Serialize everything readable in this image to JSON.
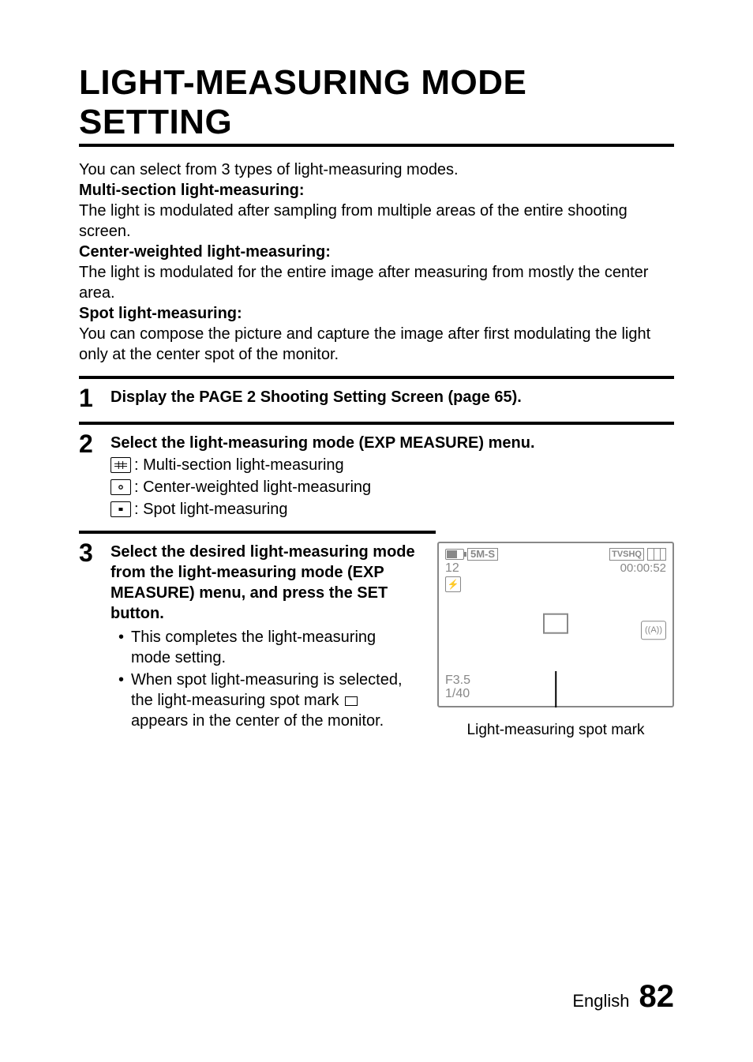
{
  "title": "LIGHT-MEASURING MODE SETTING",
  "intro": {
    "line1": "You can select from 3 types of light-measuring modes.",
    "mode1_h": "Multi-section light-measuring:",
    "mode1_b": "The light is modulated after sampling from multiple areas of the entire shooting screen.",
    "mode2_h": "Center-weighted light-measuring:",
    "mode2_b": "The light is modulated for the entire image after measuring from mostly the center area.",
    "mode3_h": "Spot light-measuring:",
    "mode3_b": "You can compose the picture and capture the image after first modulating the light only at the center spot of the monitor."
  },
  "steps": {
    "s1": {
      "num": "1",
      "title": "Display the PAGE 2 Shooting Setting Screen (page 65)."
    },
    "s2": {
      "num": "2",
      "title": "Select the light-measuring mode (EXP MEASURE) menu.",
      "opts": {
        "a": ": Multi-section light-measuring",
        "b": ": Center-weighted light-measuring",
        "c": ": Spot light-measuring"
      }
    },
    "s3": {
      "num": "3",
      "title": "Select the desired light-measuring mode from the light-measuring mode (EXP MEASURE) menu, and press the SET button.",
      "b1": "This completes the light-measuring mode setting.",
      "b2a": "When spot light-measuring is selected, the light-measuring spot mark ",
      "b2b": " appears in the center of the monitor."
    }
  },
  "lcd": {
    "res": "5M-S",
    "shots": "12",
    "tv": "TVSHQ",
    "time": "00:00:52",
    "aperture": "F3.5",
    "shutter": "1/40",
    "stab": "((A))"
  },
  "lcd_caption": "Light-measuring spot mark",
  "footer": {
    "lang": "English",
    "page": "82"
  }
}
